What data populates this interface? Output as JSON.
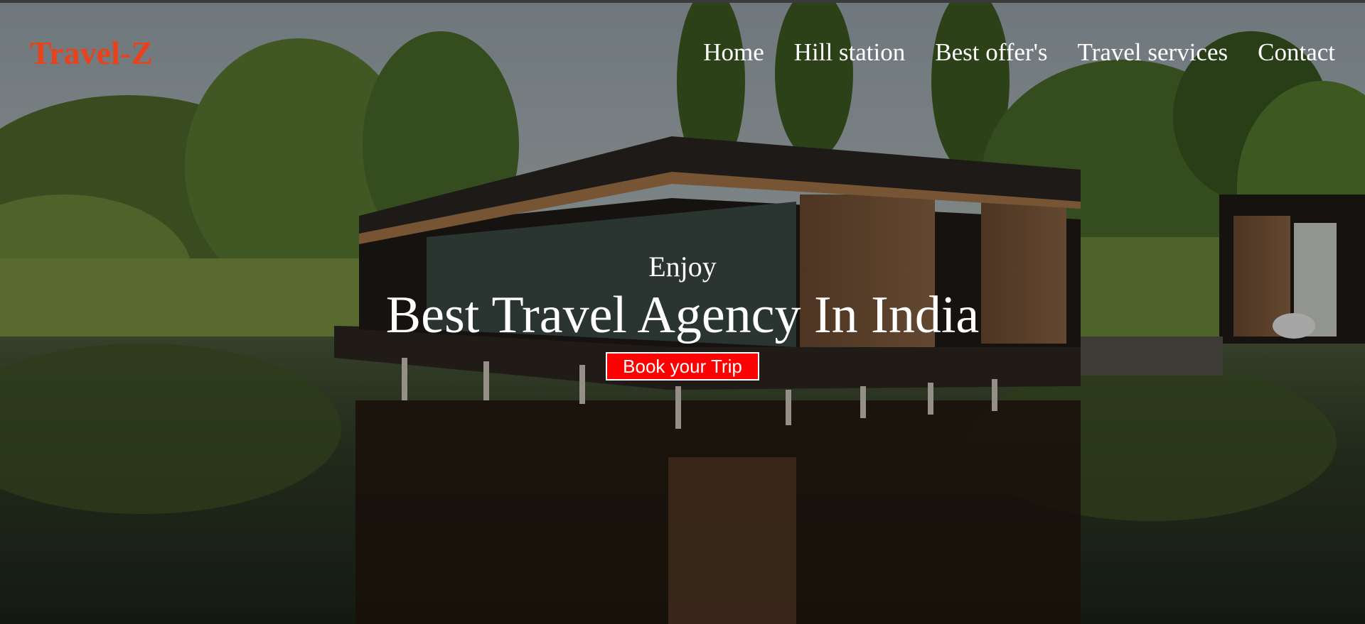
{
  "brand": {
    "logo_text": "Travel-Z",
    "logo_color": "#e8421c"
  },
  "nav": {
    "items": [
      {
        "label": "Home"
      },
      {
        "label": "Hill station"
      },
      {
        "label": "Best offer's"
      },
      {
        "label": "Travel services"
      },
      {
        "label": "Contact"
      }
    ]
  },
  "hero": {
    "subtitle": "Enjoy",
    "title": "Best Travel Agency In India",
    "cta_label": "Book your Trip",
    "cta_color": "#ff0000",
    "background_scene": "lakeside-house-photo"
  }
}
